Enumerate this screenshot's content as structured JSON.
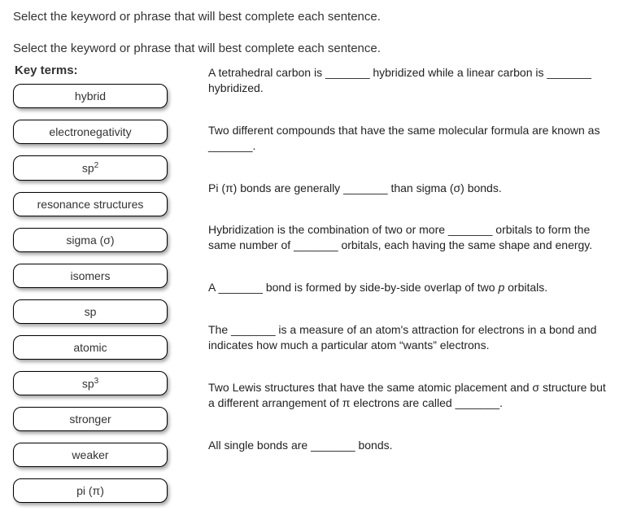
{
  "header": "Select the keyword or phrase that will best complete each sentence.",
  "subheader": "Select the keyword or phrase that will best complete each sentence.",
  "keyTermsLabel": "Key terms:",
  "terms": [
    {
      "label": "hybrid"
    },
    {
      "label": "electronegativity"
    },
    {
      "label_html": "sp<sup>2</sup>"
    },
    {
      "label": "resonance structures"
    },
    {
      "label": "sigma (σ)"
    },
    {
      "label": "isomers"
    },
    {
      "label": "sp"
    },
    {
      "label": "atomic"
    },
    {
      "label_html": "sp<sup>3</sup>"
    },
    {
      "label": "stronger"
    },
    {
      "label": "weaker"
    },
    {
      "label": "pi (π)"
    }
  ],
  "sentences": [
    {
      "html": "A tetrahedral carbon is _______ hybridized while a linear carbon is _______ hybridized."
    },
    {
      "html": "Two different compounds that have the same molecular formula are known as _______."
    },
    {
      "html": "Pi (π) bonds are generally _______ than sigma (σ) bonds."
    },
    {
      "html": "Hybridization is the combination of two or more _______ orbitals to form the same number of _______ orbitals, each having the same shape and energy."
    },
    {
      "html": "A _______ bond is formed by side-by-side overlap of two <span class=\"ital\">p</span> orbitals."
    },
    {
      "html": "The _______ is a measure of an atom's attraction for electrons in a bond and indicates how much a particular atom “wants” electrons."
    },
    {
      "html": "Two Lewis structures that have the same atomic placement and σ structure but a different arrangement of π electrons are called _______."
    },
    {
      "html": "All single bonds are _______ bonds."
    }
  ]
}
